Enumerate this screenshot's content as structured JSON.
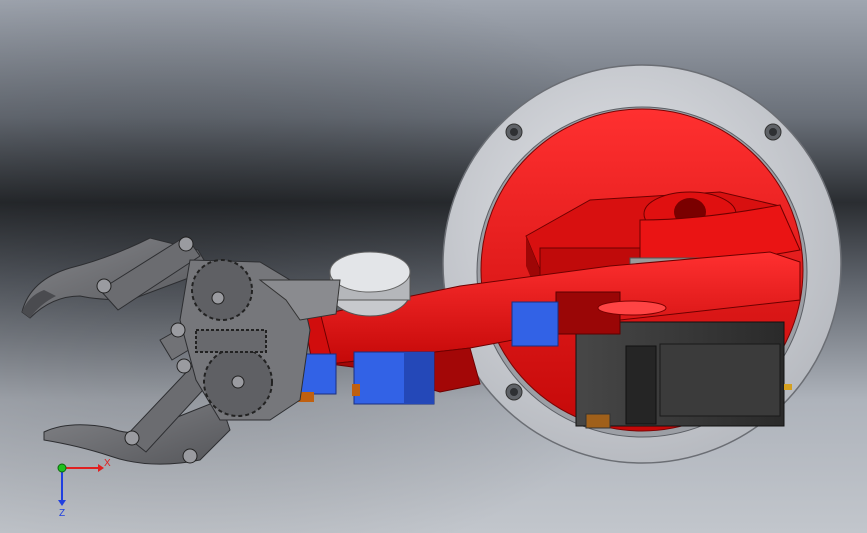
{
  "viewport": {
    "background_top": "#8f96a1",
    "background_mid": "#2b2e33",
    "background_bottom": "#b7bcc4"
  },
  "model": {
    "base_ring_color": "#c9cbd0",
    "base_plate_color": "#ee1111",
    "arm_color": "#ee1111",
    "servo_color": "#3a3a3a",
    "gripper_color": "#6e6f72",
    "accent_blue": "#2f5fe0"
  },
  "triad": {
    "x_label": "X",
    "z_label": "Z",
    "x_color": "#e02020",
    "y_color": "#20c020",
    "z_color": "#2040e0"
  }
}
